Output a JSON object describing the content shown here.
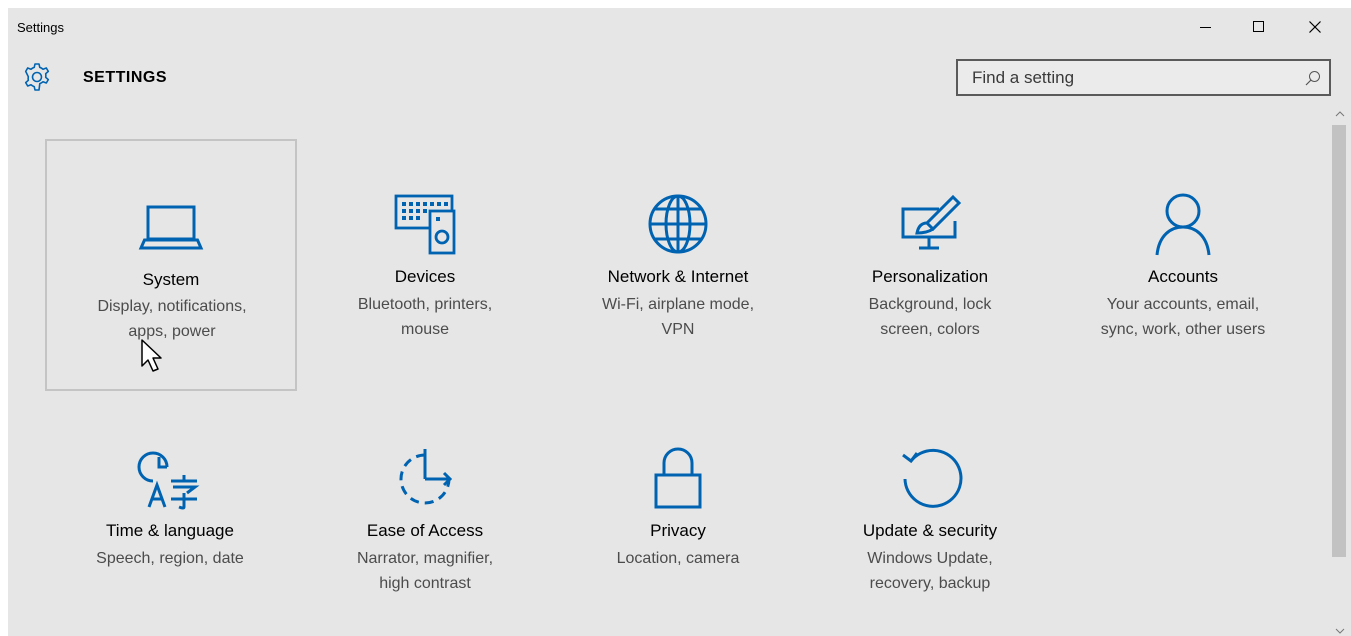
{
  "window": {
    "title": "Settings",
    "controls": {
      "minimize": "minimize",
      "maximize": "maximize",
      "close": "close"
    }
  },
  "header": {
    "icon": "gear-icon",
    "title": "SETTINGS"
  },
  "search": {
    "placeholder": "Find a setting",
    "value": "",
    "icon": "search-icon"
  },
  "accent_color": "#0063b1",
  "background_color": "#e6e6e6",
  "categories": [
    {
      "id": "system",
      "icon": "laptop-icon",
      "name": "System",
      "desc_line1": "Display, notifications,",
      "desc_line2": "apps, power",
      "selected": true
    },
    {
      "id": "devices",
      "icon": "devices-icon",
      "name": "Devices",
      "desc_line1": "Bluetooth, printers,",
      "desc_line2": "mouse"
    },
    {
      "id": "network",
      "icon": "globe-icon",
      "name": "Network & Internet",
      "desc_line1": "Wi-Fi, airplane mode,",
      "desc_line2": "VPN"
    },
    {
      "id": "personalization",
      "icon": "personalization-icon",
      "name": "Personalization",
      "desc_line1": "Background, lock",
      "desc_line2": "screen, colors"
    },
    {
      "id": "accounts",
      "icon": "person-icon",
      "name": "Accounts",
      "desc_line1": "Your accounts, email,",
      "desc_line2": "sync, work, other users"
    },
    {
      "id": "time-language",
      "icon": "time-language-icon",
      "name": "Time & language",
      "desc_line1": "Speech, region, date",
      "desc_line2": ""
    },
    {
      "id": "ease-of-access",
      "icon": "ease-of-access-icon",
      "name": "Ease of Access",
      "desc_line1": "Narrator, magnifier,",
      "desc_line2": "high contrast"
    },
    {
      "id": "privacy",
      "icon": "lock-icon",
      "name": "Privacy",
      "desc_line1": "Location, camera",
      "desc_line2": ""
    },
    {
      "id": "update-security",
      "icon": "sync-icon",
      "name": "Update & security",
      "desc_line1": "Windows Update,",
      "desc_line2": "recovery, backup"
    }
  ]
}
